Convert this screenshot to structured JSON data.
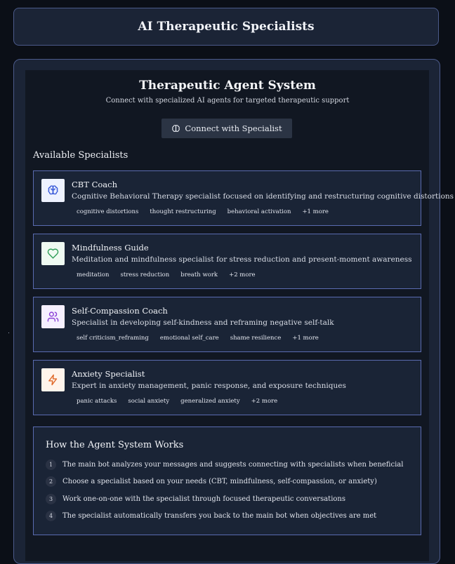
{
  "header": {
    "title": "AI Therapeutic Specialists"
  },
  "system": {
    "title": "Therapeutic Agent System",
    "subtitle": "Connect with specialized AI agents for targeted therapeutic support",
    "connect_label": "Connect with Specialist"
  },
  "available_label": "Available Specialists",
  "specialists": [
    {
      "name": "CBT Coach",
      "description": "Cognitive Behavioral Therapy specialist focused on identifying and restructuring cognitive distortions",
      "icon": "brain-icon",
      "icon_bg": "#eef2ff",
      "icon_color": "#3b5bd9",
      "tags": [
        "cognitive distortions",
        "thought restructuring",
        "behavioral activation",
        "+1 more"
      ]
    },
    {
      "name": "Mindfulness Guide",
      "description": "Meditation and mindfulness specialist for stress reduction and present-moment awareness",
      "icon": "heart-icon",
      "icon_bg": "#effaf2",
      "icon_color": "#2f9e58",
      "tags": [
        "meditation",
        "stress reduction",
        "breath work",
        "+2 more"
      ]
    },
    {
      "name": "Self-Compassion Coach",
      "description": "Specialist in developing self-kindness and reframing negative self-talk",
      "icon": "users-icon",
      "icon_bg": "#f6f0ff",
      "icon_color": "#8b3fd6",
      "tags": [
        "self criticism_reframing",
        "emotional self_care",
        "shame resilience",
        "+1 more"
      ]
    },
    {
      "name": "Anxiety Specialist",
      "description": "Expert in anxiety management, panic response, and exposure techniques",
      "icon": "lightning-icon",
      "icon_bg": "#fff4ec",
      "icon_color": "#e0692a",
      "tags": [
        "panic attacks",
        "social anxiety",
        "generalized anxiety",
        "+2 more"
      ]
    }
  ],
  "how": {
    "title": "How the Agent System Works",
    "steps": [
      {
        "num": "1",
        "text": "The main bot analyzes your messages and suggests connecting with specialists when beneficial"
      },
      {
        "num": "2",
        "text": "Choose a specialist based on your needs (CBT, mindfulness, self-compassion, or anxiety)"
      },
      {
        "num": "3",
        "text": "Work one-on-one with the specialist through focused therapeutic conversations"
      },
      {
        "num": "4",
        "text": "The specialist automatically transfers you back to the main bot when objectives are met"
      }
    ]
  }
}
